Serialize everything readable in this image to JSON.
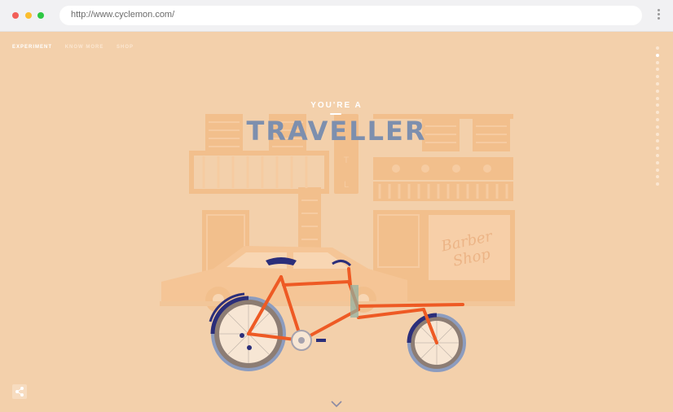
{
  "browser": {
    "url": "http://www.cyclemon.com/"
  },
  "nav": {
    "items": [
      "EXPERIMENT",
      "KNOW MORE",
      "SHOP"
    ]
  },
  "hero": {
    "kicker": "YOU'RE A",
    "title": "TRAVELLER",
    "hotel_sign": "TEL",
    "shop_sign_line1": "Barber",
    "shop_sign_line2": "Shop"
  },
  "pager": {
    "count": 20,
    "current": 2
  },
  "icons": {
    "share": "share-icon",
    "scroll_down": "chevron-down-icon",
    "menu": "kebab-menu-icon"
  },
  "colors": {
    "background": "#f3d0ab",
    "building": "#f2bf8c",
    "title": "#7d8fae",
    "frame": "#ee5a24",
    "tire": "#6e6a7a",
    "rim": "#2b2e7a"
  }
}
